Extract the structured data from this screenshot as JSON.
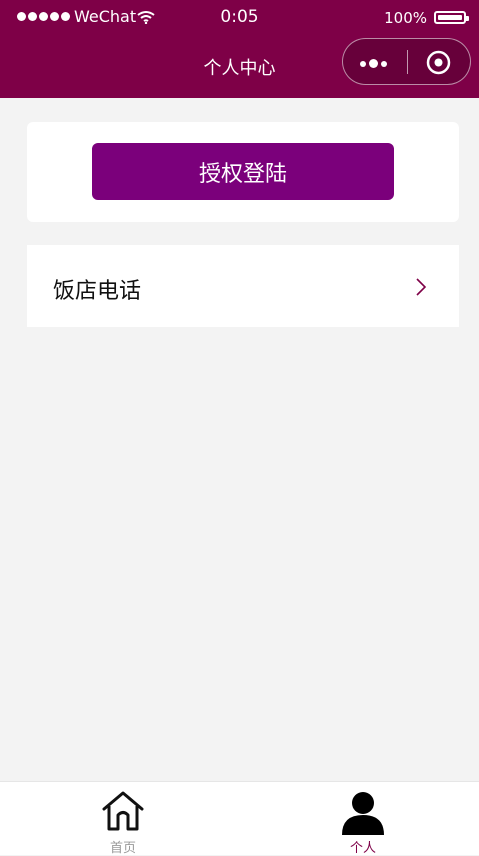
{
  "status_bar": {
    "carrier": "WeChat",
    "time": "0:05",
    "battery": "100%"
  },
  "nav": {
    "title": "个人中心"
  },
  "login": {
    "button_label": "授权登陆"
  },
  "menu": {
    "items": [
      {
        "label": "饭店电话",
        "icon": "chevron-right-icon"
      }
    ]
  },
  "tab_bar": {
    "tabs": [
      {
        "label": "首页",
        "icon": "home-icon",
        "active": false
      },
      {
        "label": "个人",
        "icon": "person-icon",
        "active": true
      }
    ]
  },
  "colors": {
    "brand": "#7e0047",
    "button": "#7b007b",
    "background": "#f3f3f3",
    "inactive_tab": "#9a9a9a"
  }
}
